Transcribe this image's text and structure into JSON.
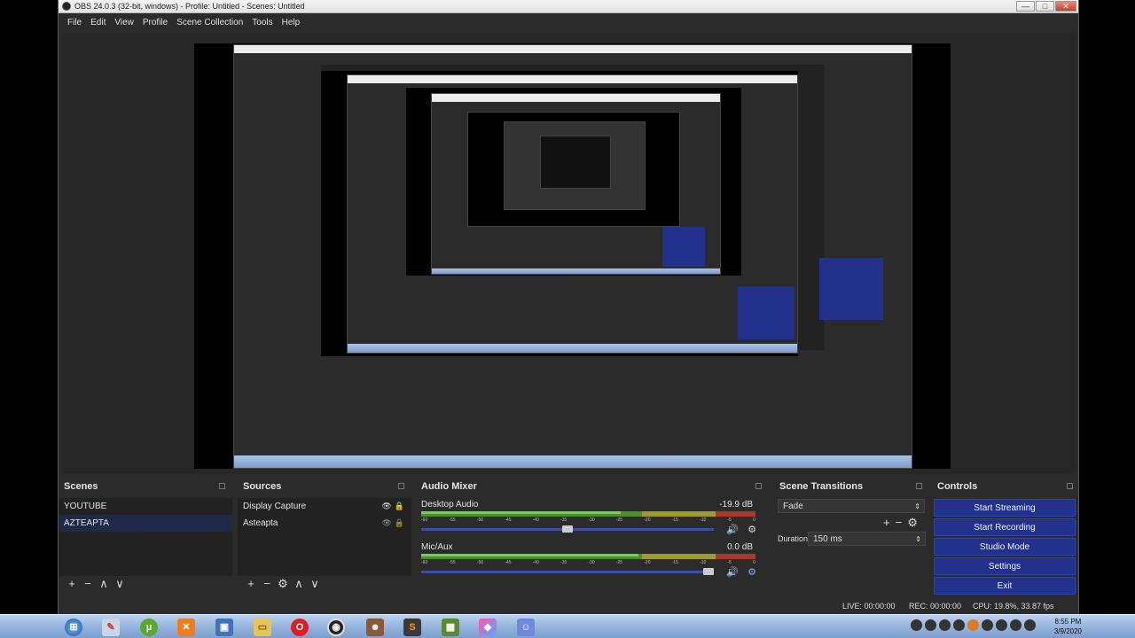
{
  "window": {
    "title": "OBS 24.0.3 (32-bit, windows) - Profile: Untitled - Scenes: Untitled",
    "min_glyph": "—",
    "max_glyph": "□",
    "close_glyph": "✕"
  },
  "menu": [
    "File",
    "Edit",
    "View",
    "Profile",
    "Scene Collection",
    "Tools",
    "Help"
  ],
  "scenes": {
    "title": "Scenes",
    "items": [
      "YOUTUBE",
      "AZTEAPTA"
    ],
    "selected": 1,
    "toolbar": [
      "+",
      "−",
      "∧",
      "∨"
    ]
  },
  "sources": {
    "title": "Sources",
    "items": [
      "Display Capture",
      "Asteapta"
    ],
    "toolbar": [
      "+",
      "−",
      "⚙",
      "∧",
      "∨"
    ]
  },
  "mixer": {
    "title": "Audio Mixer",
    "channels": [
      {
        "name": "Desktop Audio",
        "db": "-19.9 dB",
        "volume": 0.5
      },
      {
        "name": "Mic/Aux",
        "db": "0.0 dB",
        "volume": 1.0
      }
    ],
    "ticks": [
      "-60",
      "-55",
      "-50",
      "-45",
      "-40",
      "-35",
      "-30",
      "-25",
      "-20",
      "-15",
      "-10",
      "-5",
      "0"
    ]
  },
  "transitions": {
    "title": "Scene Transitions",
    "selected": "Fade",
    "duration_label": "Duration",
    "duration_value": "150 ms"
  },
  "controls": {
    "title": "Controls",
    "buttons": [
      "Start Streaming",
      "Start Recording",
      "Studio Mode",
      "Settings",
      "Exit"
    ]
  },
  "status": {
    "live": "LIVE: 00:00:00",
    "rec": "REC: 00:00:00",
    "cpu": "CPU: 19.8%, 33.87 fps"
  },
  "taskbar": {
    "apps": [
      "start-orb",
      "paint",
      "utorrent",
      "xampp",
      "remote-desktop",
      "file-explorer",
      "opera",
      "obs",
      "game-avatar",
      "sublime-text",
      "minecraft",
      "paint-3d",
      "discord"
    ],
    "time": "8:55 PM",
    "date": "3/9/2020"
  },
  "colors": {
    "accent": "#22328c",
    "selected_row": "#1f2a48",
    "meter_green": "#4a8f2c",
    "meter_yellow": "#9f9b2c",
    "meter_red": "#a8392b"
  }
}
